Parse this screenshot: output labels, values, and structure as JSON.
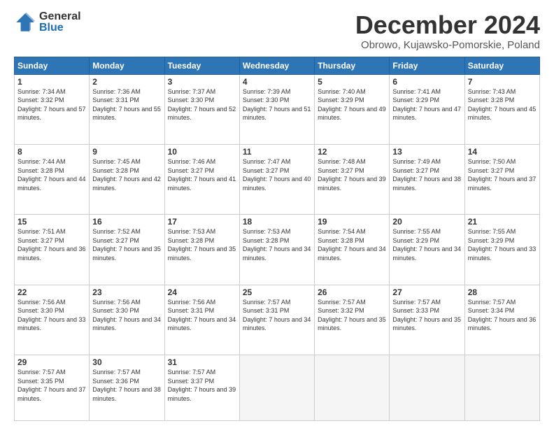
{
  "logo": {
    "general": "General",
    "blue": "Blue"
  },
  "title": "December 2024",
  "subtitle": "Obrowo, Kujawsko-Pomorskie, Poland",
  "weekdays": [
    "Sunday",
    "Monday",
    "Tuesday",
    "Wednesday",
    "Thursday",
    "Friday",
    "Saturday"
  ],
  "weeks": [
    [
      {
        "day": "1",
        "sunrise": "7:34 AM",
        "sunset": "3:32 PM",
        "daylight": "7 hours and 57 minutes."
      },
      {
        "day": "2",
        "sunrise": "7:36 AM",
        "sunset": "3:31 PM",
        "daylight": "7 hours and 55 minutes."
      },
      {
        "day": "3",
        "sunrise": "7:37 AM",
        "sunset": "3:30 PM",
        "daylight": "7 hours and 52 minutes."
      },
      {
        "day": "4",
        "sunrise": "7:39 AM",
        "sunset": "3:30 PM",
        "daylight": "7 hours and 51 minutes."
      },
      {
        "day": "5",
        "sunrise": "7:40 AM",
        "sunset": "3:29 PM",
        "daylight": "7 hours and 49 minutes."
      },
      {
        "day": "6",
        "sunrise": "7:41 AM",
        "sunset": "3:29 PM",
        "daylight": "7 hours and 47 minutes."
      },
      {
        "day": "7",
        "sunrise": "7:43 AM",
        "sunset": "3:28 PM",
        "daylight": "7 hours and 45 minutes."
      }
    ],
    [
      {
        "day": "8",
        "sunrise": "7:44 AM",
        "sunset": "3:28 PM",
        "daylight": "7 hours and 44 minutes."
      },
      {
        "day": "9",
        "sunrise": "7:45 AM",
        "sunset": "3:28 PM",
        "daylight": "7 hours and 42 minutes."
      },
      {
        "day": "10",
        "sunrise": "7:46 AM",
        "sunset": "3:27 PM",
        "daylight": "7 hours and 41 minutes."
      },
      {
        "day": "11",
        "sunrise": "7:47 AM",
        "sunset": "3:27 PM",
        "daylight": "7 hours and 40 minutes."
      },
      {
        "day": "12",
        "sunrise": "7:48 AM",
        "sunset": "3:27 PM",
        "daylight": "7 hours and 39 minutes."
      },
      {
        "day": "13",
        "sunrise": "7:49 AM",
        "sunset": "3:27 PM",
        "daylight": "7 hours and 38 minutes."
      },
      {
        "day": "14",
        "sunrise": "7:50 AM",
        "sunset": "3:27 PM",
        "daylight": "7 hours and 37 minutes."
      }
    ],
    [
      {
        "day": "15",
        "sunrise": "7:51 AM",
        "sunset": "3:27 PM",
        "daylight": "7 hours and 36 minutes."
      },
      {
        "day": "16",
        "sunrise": "7:52 AM",
        "sunset": "3:27 PM",
        "daylight": "7 hours and 35 minutes."
      },
      {
        "day": "17",
        "sunrise": "7:53 AM",
        "sunset": "3:28 PM",
        "daylight": "7 hours and 35 minutes."
      },
      {
        "day": "18",
        "sunrise": "7:53 AM",
        "sunset": "3:28 PM",
        "daylight": "7 hours and 34 minutes."
      },
      {
        "day": "19",
        "sunrise": "7:54 AM",
        "sunset": "3:28 PM",
        "daylight": "7 hours and 34 minutes."
      },
      {
        "day": "20",
        "sunrise": "7:55 AM",
        "sunset": "3:29 PM",
        "daylight": "7 hours and 34 minutes."
      },
      {
        "day": "21",
        "sunrise": "7:55 AM",
        "sunset": "3:29 PM",
        "daylight": "7 hours and 33 minutes."
      }
    ],
    [
      {
        "day": "22",
        "sunrise": "7:56 AM",
        "sunset": "3:30 PM",
        "daylight": "7 hours and 33 minutes."
      },
      {
        "day": "23",
        "sunrise": "7:56 AM",
        "sunset": "3:30 PM",
        "daylight": "7 hours and 34 minutes."
      },
      {
        "day": "24",
        "sunrise": "7:56 AM",
        "sunset": "3:31 PM",
        "daylight": "7 hours and 34 minutes."
      },
      {
        "day": "25",
        "sunrise": "7:57 AM",
        "sunset": "3:31 PM",
        "daylight": "7 hours and 34 minutes."
      },
      {
        "day": "26",
        "sunrise": "7:57 AM",
        "sunset": "3:32 PM",
        "daylight": "7 hours and 35 minutes."
      },
      {
        "day": "27",
        "sunrise": "7:57 AM",
        "sunset": "3:33 PM",
        "daylight": "7 hours and 35 minutes."
      },
      {
        "day": "28",
        "sunrise": "7:57 AM",
        "sunset": "3:34 PM",
        "daylight": "7 hours and 36 minutes."
      }
    ],
    [
      {
        "day": "29",
        "sunrise": "7:57 AM",
        "sunset": "3:35 PM",
        "daylight": "7 hours and 37 minutes."
      },
      {
        "day": "30",
        "sunrise": "7:57 AM",
        "sunset": "3:36 PM",
        "daylight": "7 hours and 38 minutes."
      },
      {
        "day": "31",
        "sunrise": "7:57 AM",
        "sunset": "3:37 PM",
        "daylight": "7 hours and 39 minutes."
      },
      null,
      null,
      null,
      null
    ]
  ]
}
